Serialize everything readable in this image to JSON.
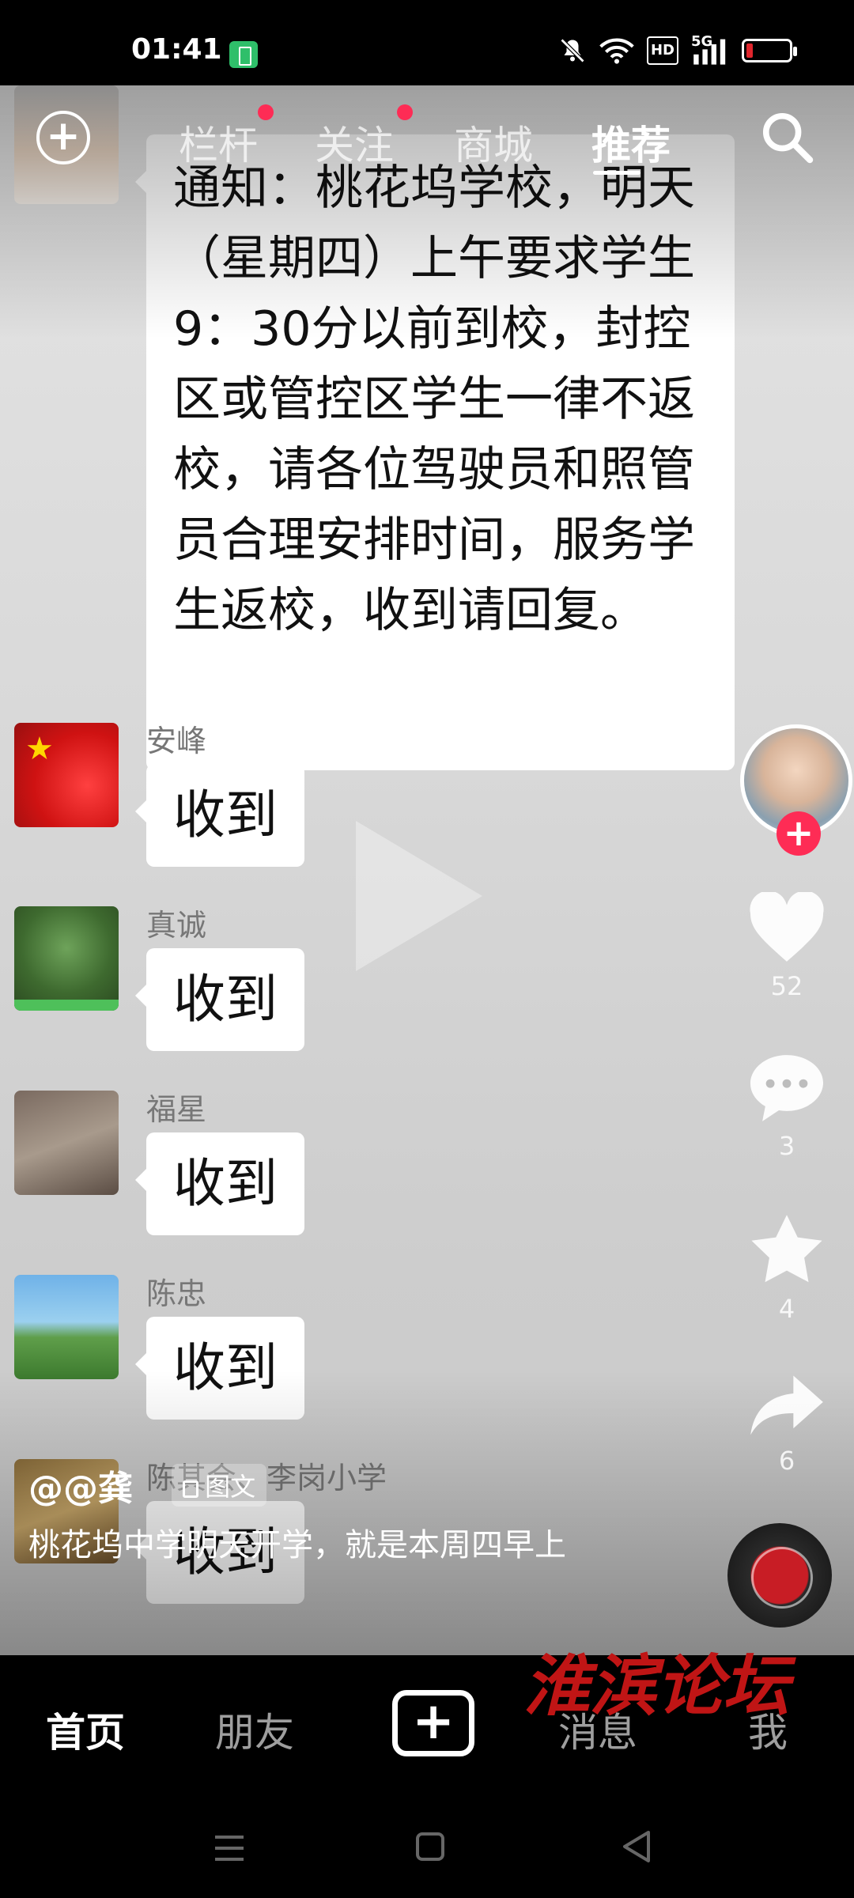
{
  "status_bar": {
    "time": "01:41",
    "network": "5G",
    "hd": "HD",
    "battery_color": "#e0262d"
  },
  "top_tabs": {
    "items": [
      {
        "label": "栏杆",
        "dot": true
      },
      {
        "label": "关注",
        "dot": true
      },
      {
        "label": "商城",
        "dot": false
      },
      {
        "label": "推荐",
        "dot": false,
        "active": true
      }
    ]
  },
  "chat": {
    "notice_text": "通知：桃花坞学校，明天（星期四）上午要求学生9：30分以前到校，封控区或管控区学生一律不返校，请各位驾驶员和照管员合理安排时间，服务学生返校，收到请回复。",
    "messages": [
      {
        "sender": "安峰",
        "text": "收到"
      },
      {
        "sender": "真诚",
        "text": "收到"
      },
      {
        "sender": "福星",
        "text": "收到"
      },
      {
        "sender": "陈忠",
        "text": "收到"
      },
      {
        "sender": "陈其会、李岗小学",
        "text": "收到"
      }
    ]
  },
  "right_rail": {
    "likes": "52",
    "comments": "3",
    "favorites": "4",
    "shares": "6"
  },
  "caption": {
    "author": "@@龚",
    "post_type": "图文",
    "text": "桃花坞中学明天开学，就是本周四早上"
  },
  "bottom_nav": {
    "items": [
      "首页",
      "朋友",
      "消息",
      "我"
    ],
    "create_label": "+"
  },
  "watermark": "淮滨论坛",
  "colors": {
    "accent": "#fe2c55",
    "watermark": "#c01515"
  }
}
